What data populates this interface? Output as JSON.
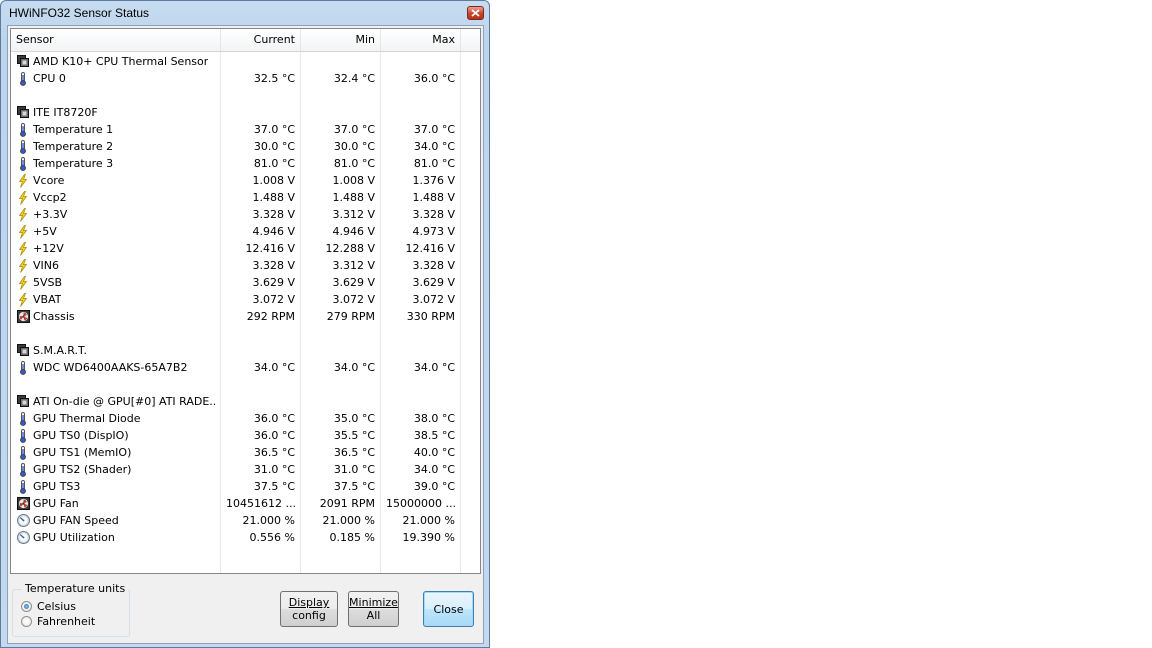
{
  "window": {
    "title": "HWiNFO32 Sensor Status"
  },
  "columns": {
    "sensor": "Sensor",
    "current": "Current",
    "min": "Min",
    "max": "Max"
  },
  "rows": [
    {
      "icon": "chip-icon",
      "label": "AMD K10+ CPU Thermal Sensor",
      "current": "",
      "min": "",
      "max": ""
    },
    {
      "icon": "thermometer-icon",
      "label": "CPU 0",
      "current": "32.5 °C",
      "min": "32.4 °C",
      "max": "36.0 °C"
    },
    {
      "icon": "",
      "label": "",
      "current": "",
      "min": "",
      "max": ""
    },
    {
      "icon": "chip-icon",
      "label": "ITE IT8720F",
      "current": "",
      "min": "",
      "max": ""
    },
    {
      "icon": "thermometer-icon",
      "label": "Temperature 1",
      "current": "37.0 °C",
      "min": "37.0 °C",
      "max": "37.0 °C"
    },
    {
      "icon": "thermometer-icon",
      "label": "Temperature 2",
      "current": "30.0 °C",
      "min": "30.0 °C",
      "max": "34.0 °C"
    },
    {
      "icon": "thermometer-icon",
      "label": "Temperature 3",
      "current": "81.0 °C",
      "min": "81.0 °C",
      "max": "81.0 °C"
    },
    {
      "icon": "lightning-icon",
      "label": "Vcore",
      "current": "1.008 V",
      "min": "1.008 V",
      "max": "1.376 V"
    },
    {
      "icon": "lightning-icon",
      "label": "Vccp2",
      "current": "1.488 V",
      "min": "1.488 V",
      "max": "1.488 V"
    },
    {
      "icon": "lightning-icon",
      "label": "+3.3V",
      "current": "3.328 V",
      "min": "3.312 V",
      "max": "3.328 V"
    },
    {
      "icon": "lightning-icon",
      "label": "+5V",
      "current": "4.946 V",
      "min": "4.946 V",
      "max": "4.973 V"
    },
    {
      "icon": "lightning-icon",
      "label": "+12V",
      "current": "12.416 V",
      "min": "12.288 V",
      "max": "12.416 V"
    },
    {
      "icon": "lightning-icon",
      "label": "VIN6",
      "current": "3.328 V",
      "min": "3.312 V",
      "max": "3.328 V"
    },
    {
      "icon": "lightning-icon",
      "label": "5VSB",
      "current": "3.629 V",
      "min": "3.629 V",
      "max": "3.629 V"
    },
    {
      "icon": "lightning-icon",
      "label": "VBAT",
      "current": "3.072 V",
      "min": "3.072 V",
      "max": "3.072 V"
    },
    {
      "icon": "fan-icon",
      "label": "Chassis",
      "current": "292 RPM",
      "min": "279 RPM",
      "max": "330 RPM"
    },
    {
      "icon": "",
      "label": "",
      "current": "",
      "min": "",
      "max": ""
    },
    {
      "icon": "chip-icon",
      "label": "S.M.A.R.T.",
      "current": "",
      "min": "",
      "max": ""
    },
    {
      "icon": "thermometer-icon",
      "label": "WDC WD6400AAKS-65A7B2",
      "current": "34.0 °C",
      "min": "34.0 °C",
      "max": "34.0 °C"
    },
    {
      "icon": "",
      "label": "",
      "current": "",
      "min": "",
      "max": ""
    },
    {
      "icon": "chip-icon",
      "label": "ATI On-die @ GPU[#0] ATI RADE...",
      "current": "",
      "min": "",
      "max": ""
    },
    {
      "icon": "thermometer-icon",
      "label": "GPU Thermal Diode",
      "current": "36.0 °C",
      "min": "35.0 °C",
      "max": "38.0 °C"
    },
    {
      "icon": "thermometer-icon",
      "label": "GPU TS0 (DispIO)",
      "current": "36.0 °C",
      "min": "35.5 °C",
      "max": "38.5 °C"
    },
    {
      "icon": "thermometer-icon",
      "label": "GPU TS1 (MemIO)",
      "current": "36.5 °C",
      "min": "36.5 °C",
      "max": "40.0 °C"
    },
    {
      "icon": "thermometer-icon",
      "label": "GPU TS2 (Shader)",
      "current": "31.0 °C",
      "min": "31.0 °C",
      "max": "34.0 °C"
    },
    {
      "icon": "thermometer-icon",
      "label": "GPU TS3",
      "current": "37.5 °C",
      "min": "37.5 °C",
      "max": "39.0 °C"
    },
    {
      "icon": "fan-icon",
      "label": "GPU Fan",
      "current": "10451612 ...",
      "min": "2091 RPM",
      "max": "15000000 ..."
    },
    {
      "icon": "gauge-icon",
      "label": "GPU FAN Speed",
      "current": "21.000 %",
      "min": "21.000 %",
      "max": "21.000 %"
    },
    {
      "icon": "gauge-icon",
      "label": "GPU Utilization",
      "current": "0.556 %",
      "min": "0.185 %",
      "max": "19.390 %"
    }
  ],
  "units": {
    "group_title": "Temperature units",
    "celsius": "Celsius",
    "fahrenheit": "Fahrenheit",
    "selected": "Celsius"
  },
  "buttons": {
    "display_config": [
      "Display",
      "config"
    ],
    "minimize_all": [
      "Minimize",
      "All"
    ],
    "close": "Close"
  }
}
